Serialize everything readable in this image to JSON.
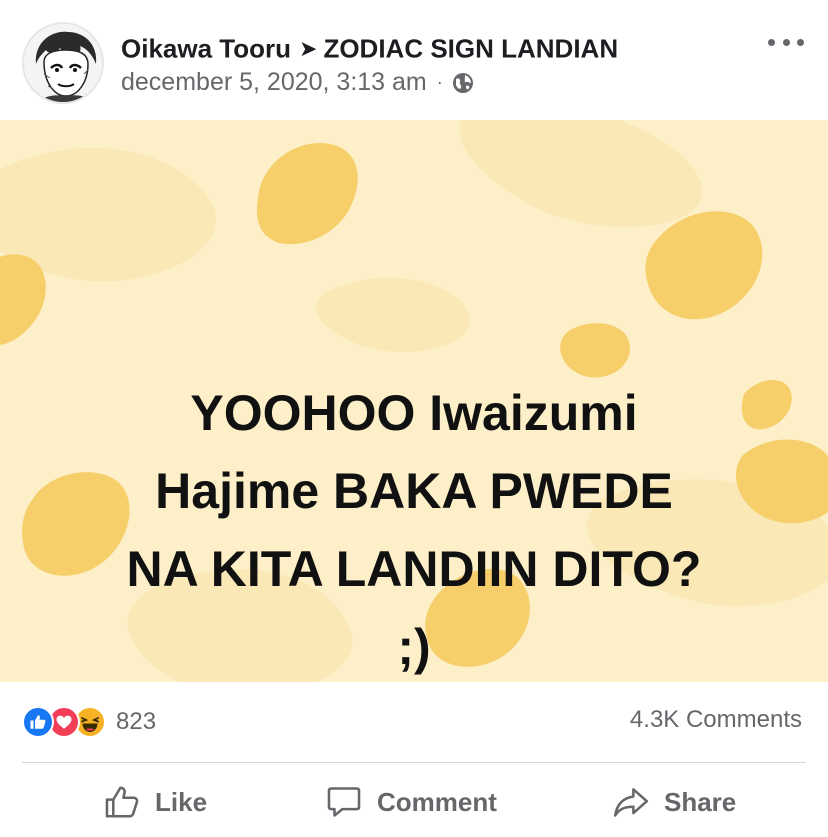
{
  "post": {
    "author": "Oikawa Tooru",
    "arrow": "➤",
    "group": "ZODIAC SIGN LANDIAN",
    "timestamp": "december 5, 2020, 3:13 am",
    "separator": "·",
    "privacy_icon": "globe-icon",
    "more_icon": "more-options-icon"
  },
  "card": {
    "lines": [
      "YOOHOO Iwaizumi",
      "Hajime BAKA PWEDE",
      "NA KITA LANDIIN DITO?",
      ";)"
    ],
    "background_color": "#fdf0c9",
    "blob_color": "#f6cf6b",
    "text_color": "#111111"
  },
  "engagement": {
    "reaction_icons": [
      "like-icon",
      "love-icon",
      "haha-icon"
    ],
    "reaction_count": "823",
    "comments_count": "4.3K Comments"
  },
  "actions": {
    "like_label": "Like",
    "comment_label": "Comment",
    "share_label": "Share"
  },
  "colors": {
    "like_blue": "#1877f2",
    "love_red": "#f33e58",
    "haha_yellow": "#f7b125",
    "secondary_text": "#65676b"
  }
}
